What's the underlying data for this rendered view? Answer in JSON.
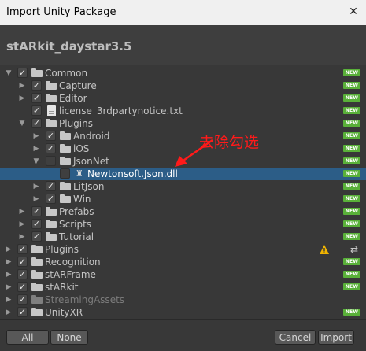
{
  "window": {
    "title": "Import Unity Package"
  },
  "package": {
    "name": "stARkit_daystar3.5"
  },
  "badge": {
    "new": "NEW"
  },
  "tree": {
    "common": "Common",
    "capture": "Capture",
    "editor": "Editor",
    "license": "license_3rdpartynotice.txt",
    "plugins": "Plugins",
    "android": "Android",
    "ios": "iOS",
    "jsonnet": "JsonNet",
    "newtonsoft": "Newtonsoft.Json.dll",
    "litjson": "LitJson",
    "win": "Win",
    "prefabs": "Prefabs",
    "scripts": "Scripts",
    "tutorial": "Tutorial",
    "root_plugins": "Plugins",
    "recognition": "Recognition",
    "starframe": "stARFrame",
    "starkit": "stARkit",
    "streamingassets": "StreamingAssets",
    "unityxr": "UnityXR"
  },
  "annotation": {
    "text": "去除勾选",
    "color": "#ff1a1a"
  },
  "buttons": {
    "all": "All",
    "none": "None",
    "cancel": "Cancel",
    "import": "Import"
  },
  "colors": {
    "selection": "#2c5d87",
    "new_badge": "#59b039",
    "warning": "#f0b400"
  },
  "icons": {
    "close": "close-icon",
    "folder": "folder-icon",
    "file": "text-file-icon",
    "dll": "dll-file-icon",
    "warning": "warning-icon",
    "swap": "swap-icon"
  }
}
